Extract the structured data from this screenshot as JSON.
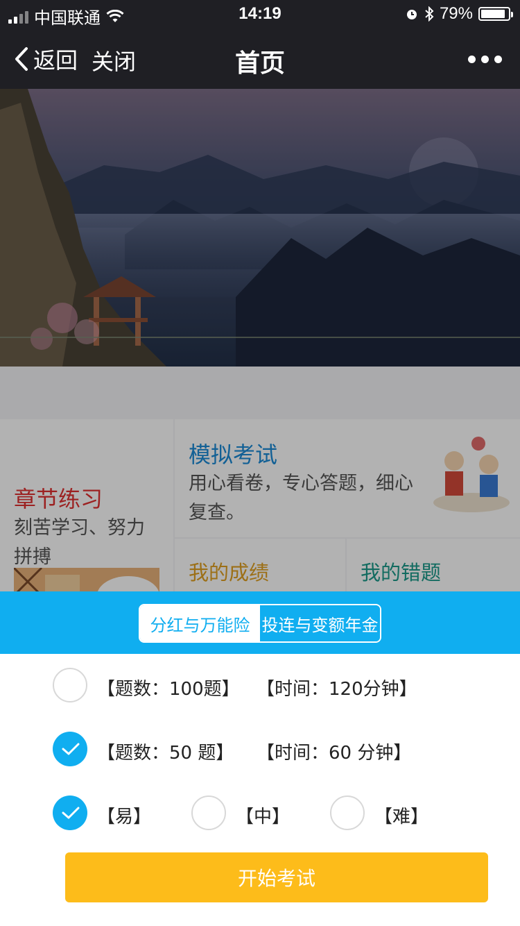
{
  "status": {
    "carrier": "中国联通",
    "time": "14:19",
    "battery": "79%"
  },
  "nav": {
    "back_label": "返回",
    "close_label": "关闭",
    "title": "首页"
  },
  "content": {
    "chapter": {
      "title": "章节练习",
      "desc": "刻苦学习、努力拼搏"
    },
    "mock": {
      "title": "模拟考试",
      "desc": "用心看卷，专心答题，细心复查。"
    },
    "scores": {
      "title": "我的成绩"
    },
    "mistakes": {
      "title": "我的错题"
    }
  },
  "sheet": {
    "tabs": [
      {
        "label": "分红与万能险",
        "selected": true
      },
      {
        "label": "投连与变额年金",
        "selected": false
      }
    ],
    "options": [
      {
        "count": "【题数：100题】",
        "time": "【时间：120分钟】",
        "checked": false
      },
      {
        "count": "【题数：50 题】",
        "time": "【时间：60 分钟】",
        "checked": true
      }
    ],
    "difficulty": [
      {
        "label": "【易】",
        "checked": true
      },
      {
        "label": "【中】",
        "checked": false
      },
      {
        "label": "【难】",
        "checked": false
      }
    ],
    "start_label": "开始考试"
  },
  "colors": {
    "accent": "#10aef0",
    "button": "#fdbc1a",
    "nav_bg": "#1f1f24"
  }
}
